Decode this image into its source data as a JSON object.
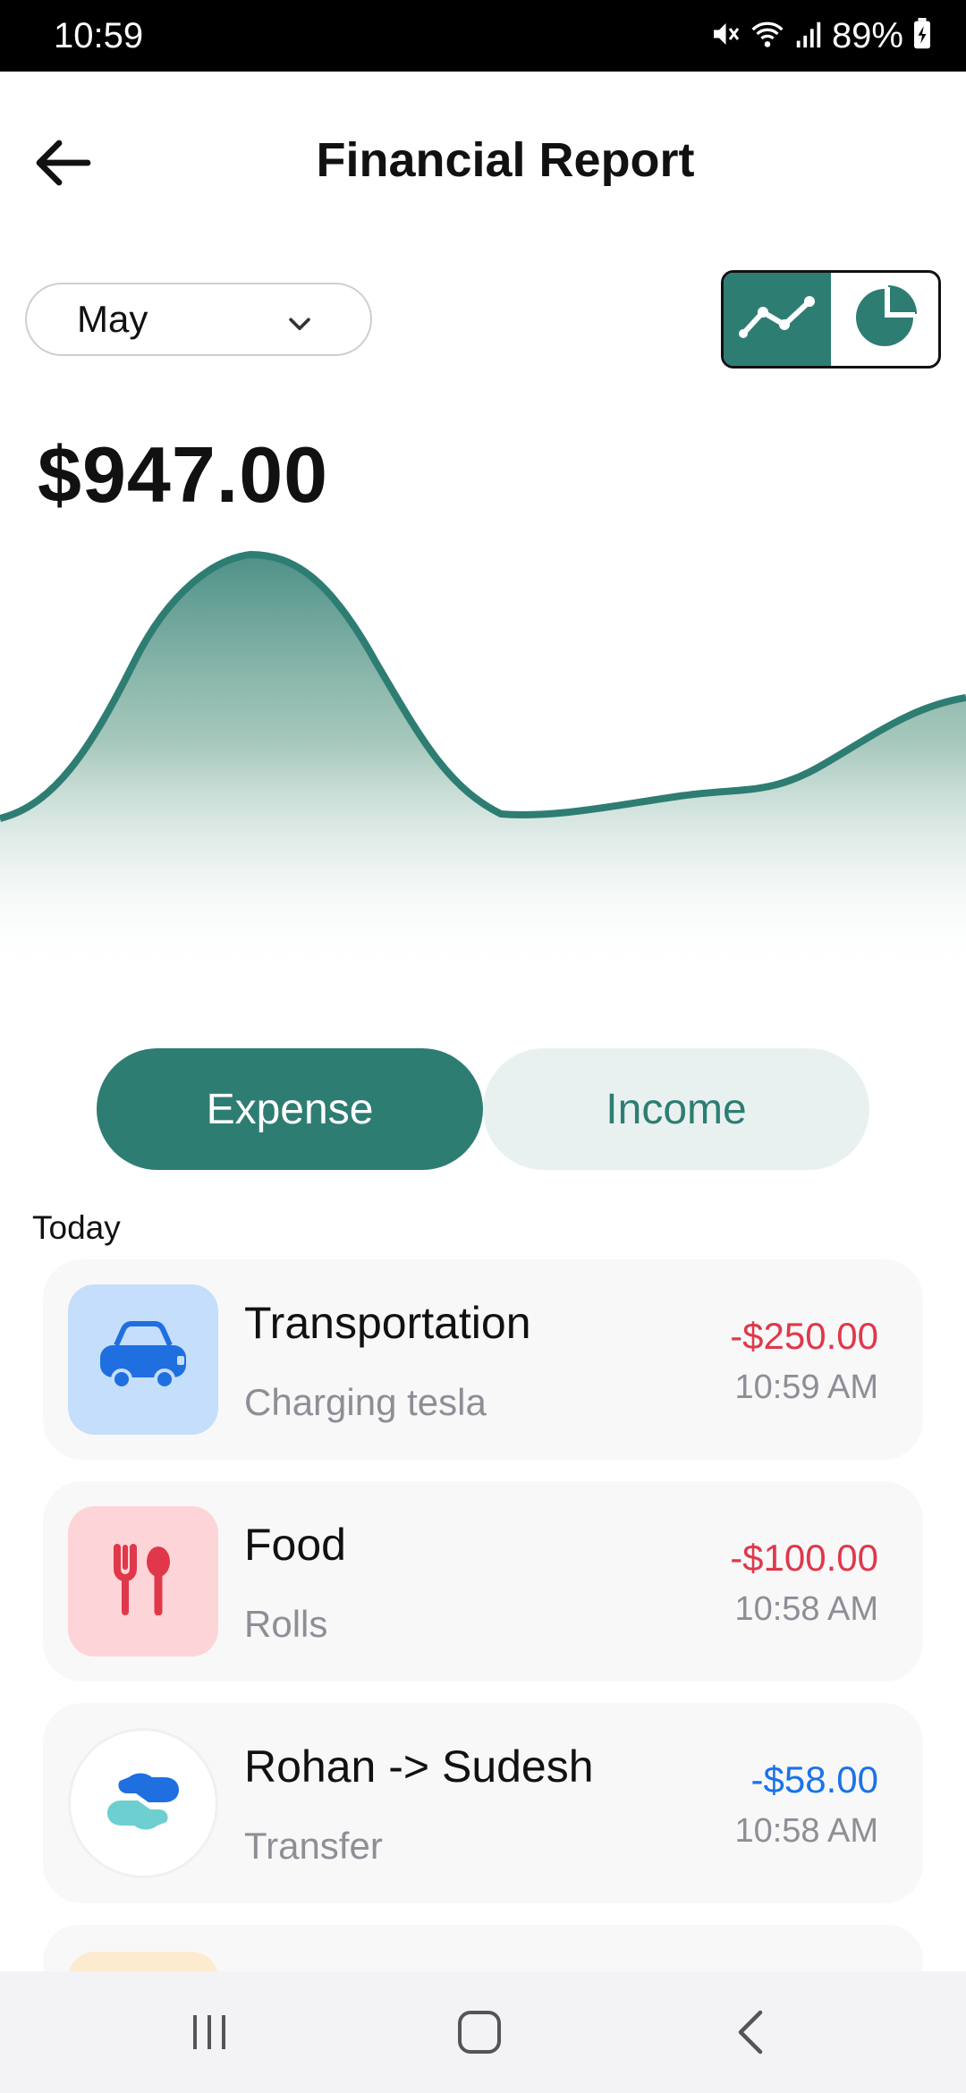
{
  "status_bar": {
    "time": "10:59",
    "battery_percent": "89%",
    "icons": [
      "mute-icon",
      "wifi-icon",
      "signal-icon",
      "battery-charging-icon"
    ]
  },
  "header": {
    "title": "Financial Report",
    "back_icon": "arrow-left-icon"
  },
  "filters": {
    "month": "May",
    "view_modes": [
      "line-chart-icon",
      "pie-chart-icon"
    ],
    "active_view": "line-chart-icon"
  },
  "summary": {
    "total": "$947.00"
  },
  "colors": {
    "accent": "#2e7d73",
    "expense": "#e0384a",
    "transfer": "#1a73e8",
    "muted": "#8e8e96"
  },
  "tabs": {
    "expense": "Expense",
    "income": "Income",
    "active": "Expense"
  },
  "sections": {
    "today": "Today"
  },
  "transactions": [
    {
      "category": "Transportation",
      "note": "Charging tesla",
      "amount": "-$250.00",
      "time": "10:59 AM",
      "icon": "car-icon"
    },
    {
      "category": "Food",
      "note": "Rolls",
      "amount": "-$100.00",
      "time": "10:58 AM",
      "icon": "fork-spoon-icon"
    },
    {
      "category": "Rohan -> Sudesh",
      "note": "Transfer",
      "amount": "-$58.00",
      "time": "10:58 AM",
      "icon": "transfer-icon"
    }
  ],
  "nav": {
    "icons": [
      "recent-apps-icon",
      "home-icon",
      "back-icon"
    ]
  }
}
